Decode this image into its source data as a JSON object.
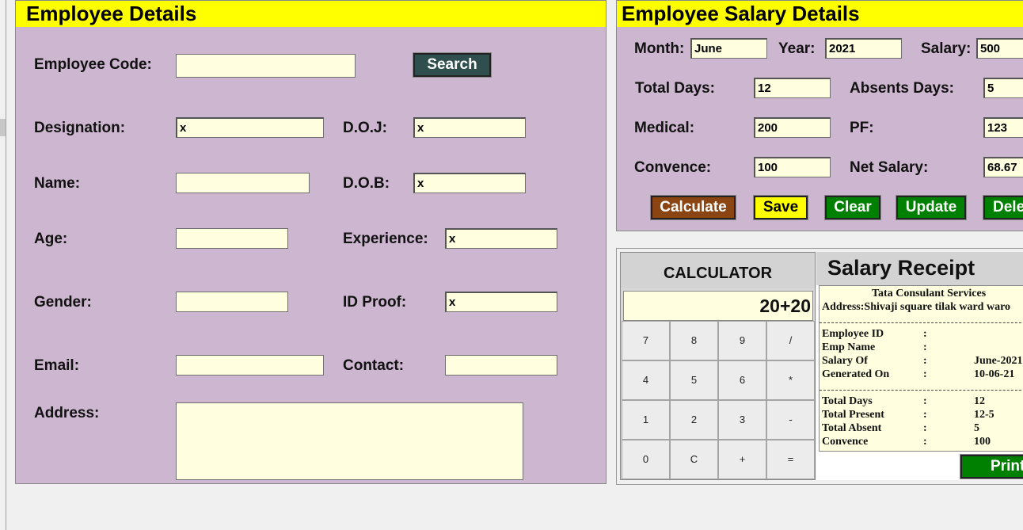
{
  "employee": {
    "title": "Employee Details",
    "code_label": "Employee Code:",
    "code_value": "",
    "search_label": "Search",
    "designation_label": "Designation:",
    "designation_value": "x",
    "doj_label": "D.O.J:",
    "doj_value": "x",
    "name_label": "Name:",
    "name_value": "",
    "dob_label": "D.O.B:",
    "dob_value": "x",
    "age_label": "Age:",
    "age_value": "",
    "experience_label": "Experience:",
    "experience_value": "x",
    "gender_label": "Gender:",
    "gender_value": "",
    "idproof_label": "ID Proof:",
    "idproof_value": "x",
    "email_label": "Email:",
    "email_value": "",
    "contact_label": "Contact:",
    "contact_value": "",
    "address_label": "Address:",
    "address_value": ""
  },
  "salary": {
    "title": "Employee Salary Details",
    "month_label": "Month:",
    "month_value": "June",
    "year_label": "Year:",
    "year_value": "2021",
    "salary_label": "Salary:",
    "salary_value": "500",
    "total_days_label": "Total Days:",
    "total_days_value": "12",
    "absents_label": "Absents Days:",
    "absents_value": "5",
    "medical_label": "Medical:",
    "medical_value": "200",
    "pf_label": "PF:",
    "pf_value": "123",
    "convence_label": "Convence:",
    "convence_value": "100",
    "net_salary_label": "Net Salary:",
    "net_salary_value": "68.67",
    "buttons": {
      "calculate": "Calculate",
      "save": "Save",
      "clear": "Clear",
      "update": "Update",
      "delete": "Dele"
    }
  },
  "calculator": {
    "title": "CALCULATOR",
    "display": "20+20",
    "keys": [
      "7",
      "8",
      "9",
      "/",
      "4",
      "5",
      "6",
      "*",
      "1",
      "2",
      "3",
      "-",
      "0",
      "C",
      "+",
      "="
    ]
  },
  "receipt": {
    "title": "Salary Receipt",
    "company": "Tata Consulant Services",
    "address": "Address:Shivaji square tilak ward waro",
    "rows_top": [
      {
        "label": "Employee ID",
        "sep": ":",
        "value": ""
      },
      {
        "label": "Emp Name",
        "sep": ":",
        "value": ""
      },
      {
        "label": "Salary Of",
        "sep": ":",
        "value": "June-2021"
      },
      {
        "label": "Generated On",
        "sep": ":",
        "value": "10-06-21"
      }
    ],
    "rows_bottom": [
      {
        "label": "Total Days",
        "sep": ":",
        "value": "12"
      },
      {
        "label": "Total Present",
        "sep": ":",
        "value": "12-5"
      },
      {
        "label": "Total Absent",
        "sep": ":",
        "value": "5"
      },
      {
        "label": "Convence",
        "sep": ":",
        "value": "100"
      }
    ],
    "print_label": "Print"
  }
}
